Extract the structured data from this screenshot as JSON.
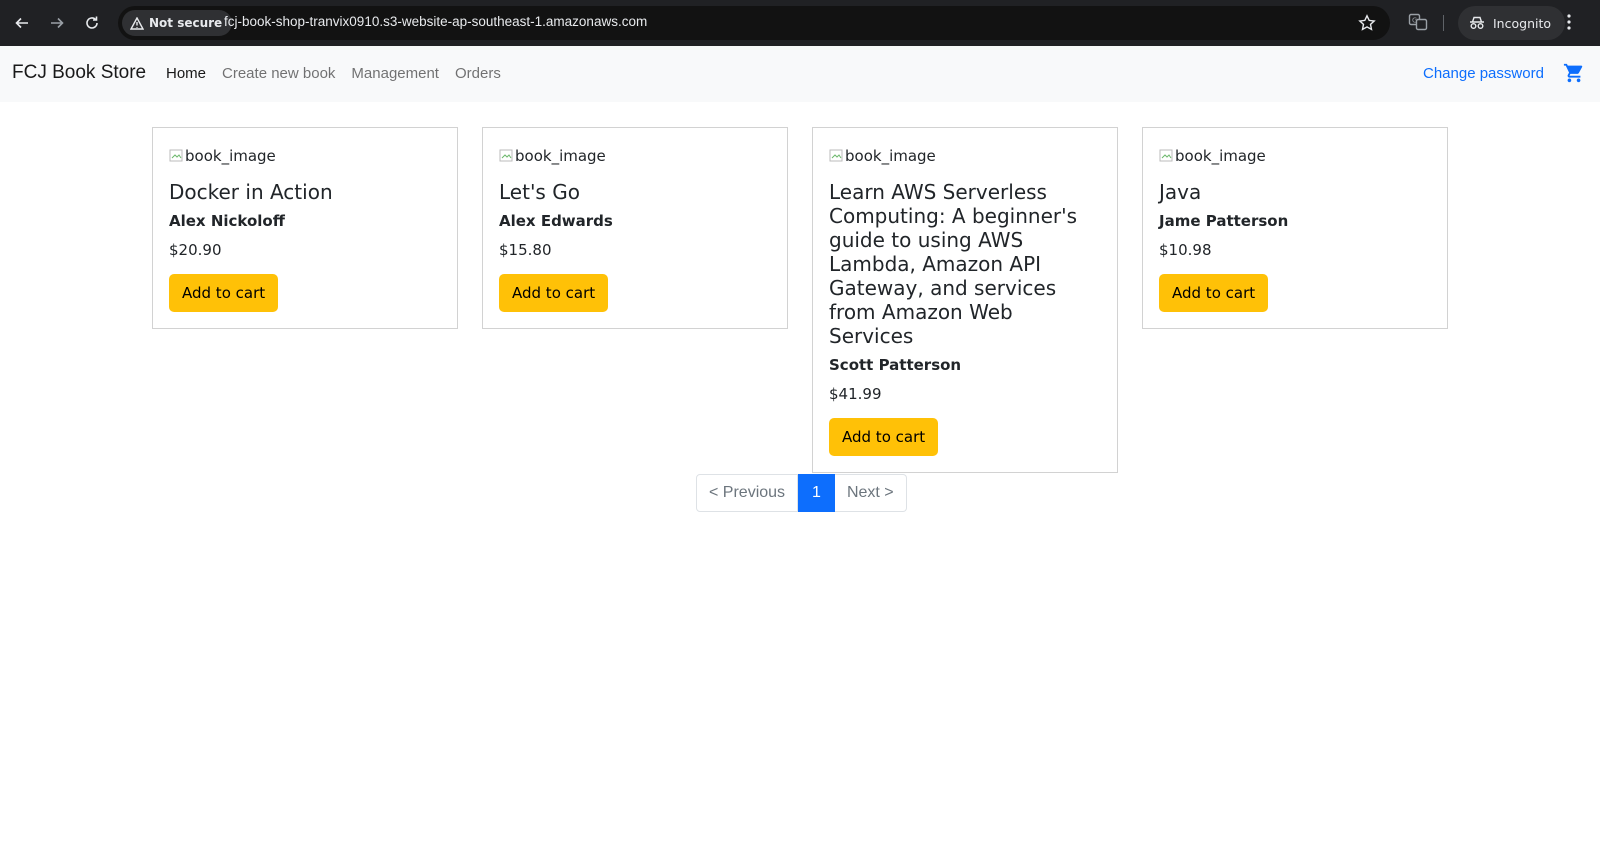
{
  "browser": {
    "security_label": "Not secure",
    "url": "fcj-book-shop-tranvix0910.s3-website-ap-southeast-1.amazonaws.com",
    "incognito_label": "Incognito"
  },
  "navbar": {
    "brand": "FCJ Book Store",
    "links": [
      "Home",
      "Create new book",
      "Management",
      "Orders"
    ],
    "change_password": "Change password",
    "cart_icon": "cart-icon"
  },
  "books": [
    {
      "image_alt": "book_image",
      "title": "Docker in Action",
      "author": "Alex Nickoloff",
      "price": "$20.90",
      "button": "Add to cart"
    },
    {
      "image_alt": "book_image",
      "title": "Let's Go",
      "author": "Alex Edwards",
      "price": "$15.80",
      "button": "Add to cart"
    },
    {
      "image_alt": "book_image",
      "title": "Learn AWS Serverless Computing: A beginner's guide to using AWS Lambda, Amazon API Gateway, and services from Amazon Web Services",
      "author": "Scott Patterson",
      "price": "$41.99",
      "button": "Add to cart"
    },
    {
      "image_alt": "book_image",
      "title": "Java",
      "author": "Jame Patterson",
      "price": "$10.98",
      "button": "Add to cart"
    }
  ],
  "pagination": {
    "previous": "< Previous",
    "current": "1",
    "next": "Next >"
  },
  "colors": {
    "accent": "#0d6efd",
    "button": "#ffc107",
    "navbar_bg": "#f8f9fa"
  }
}
